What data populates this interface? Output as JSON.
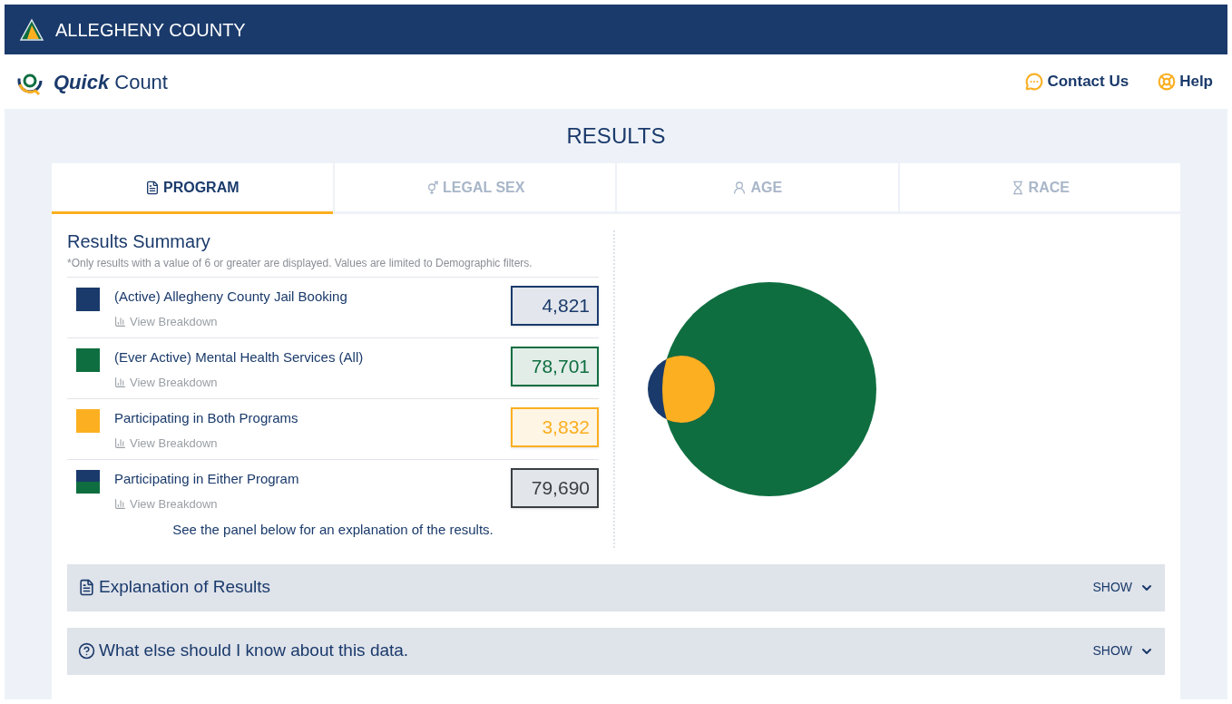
{
  "top_bar": {
    "title": "ALLEGHENY COUNTY"
  },
  "header": {
    "logo_bold": "Quick",
    "logo_text": "Count",
    "links": [
      {
        "kind": "contact",
        "label": "Contact Us"
      },
      {
        "kind": "help",
        "label": "Help"
      }
    ]
  },
  "page_title": "RESULTS",
  "tabs": [
    {
      "kind": "program",
      "label": "PROGRAM",
      "selected": true
    },
    {
      "kind": "sex",
      "label": "LEGAL SEX",
      "selected": false
    },
    {
      "kind": "age",
      "label": "AGE",
      "selected": false
    },
    {
      "kind": "race",
      "label": "RACE",
      "selected": false
    }
  ],
  "summary": {
    "title": "Results Summary",
    "note": "*Only results with a value of 6 or greater are displayed. Values are limited to Demographic filters.",
    "items": [
      {
        "kind": "single",
        "color": "#1a3a6b",
        "label": "(Active) Allegheny County Jail Booking",
        "link": "View Breakdown",
        "value": "4,821"
      },
      {
        "kind": "single",
        "color": "#0f6e40",
        "label": "(Ever Active) Mental Health Services (All)",
        "link": "View Breakdown",
        "value": "78,701"
      },
      {
        "kind": "single",
        "color": "#fbaf21",
        "label": "Participating in Both Programs",
        "link": "View Breakdown",
        "value": "3,832"
      },
      {
        "kind": "split",
        "swatch": [
          {
            "color": "#1a3a6b"
          },
          {
            "color": "#0f6e40"
          }
        ],
        "label": "Participating in Either Program",
        "link": "View Breakdown",
        "value": "79,690"
      }
    ],
    "footer": "See the panel below for an explanation of the results."
  },
  "panels": [
    {
      "kind": "document",
      "title": "Explanation of Results",
      "action": "SHOW",
      "expanded": false
    },
    {
      "kind": "question",
      "title": "What else should I know about this data.",
      "action": "SHOW",
      "expanded": false
    }
  ]
}
